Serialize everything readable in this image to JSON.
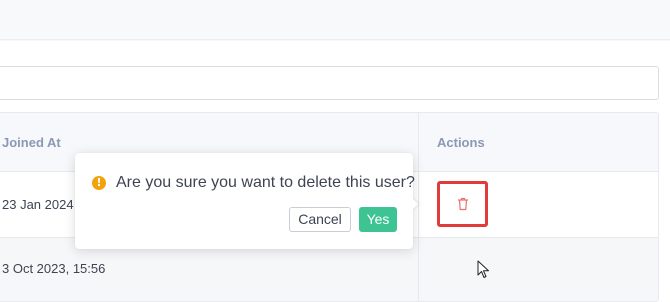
{
  "search": {
    "placeholder": ""
  },
  "table": {
    "headers": {
      "joined_at": "Joined At",
      "actions": "Actions"
    },
    "rows": [
      {
        "joined_at": "23 Jan 2024"
      },
      {
        "joined_at": "3 Oct 2023, 15:56"
      }
    ]
  },
  "popconfirm": {
    "message": "Are you sure you want to delete this user?",
    "cancel_label": "Cancel",
    "confirm_label": "Yes",
    "icon": "exclamation-circle-icon",
    "icon_color": "#f0a30c",
    "confirm_color": "#3ec492"
  },
  "delete_button": {
    "icon": "trash-icon",
    "highlight_color": "#e03c3c"
  }
}
